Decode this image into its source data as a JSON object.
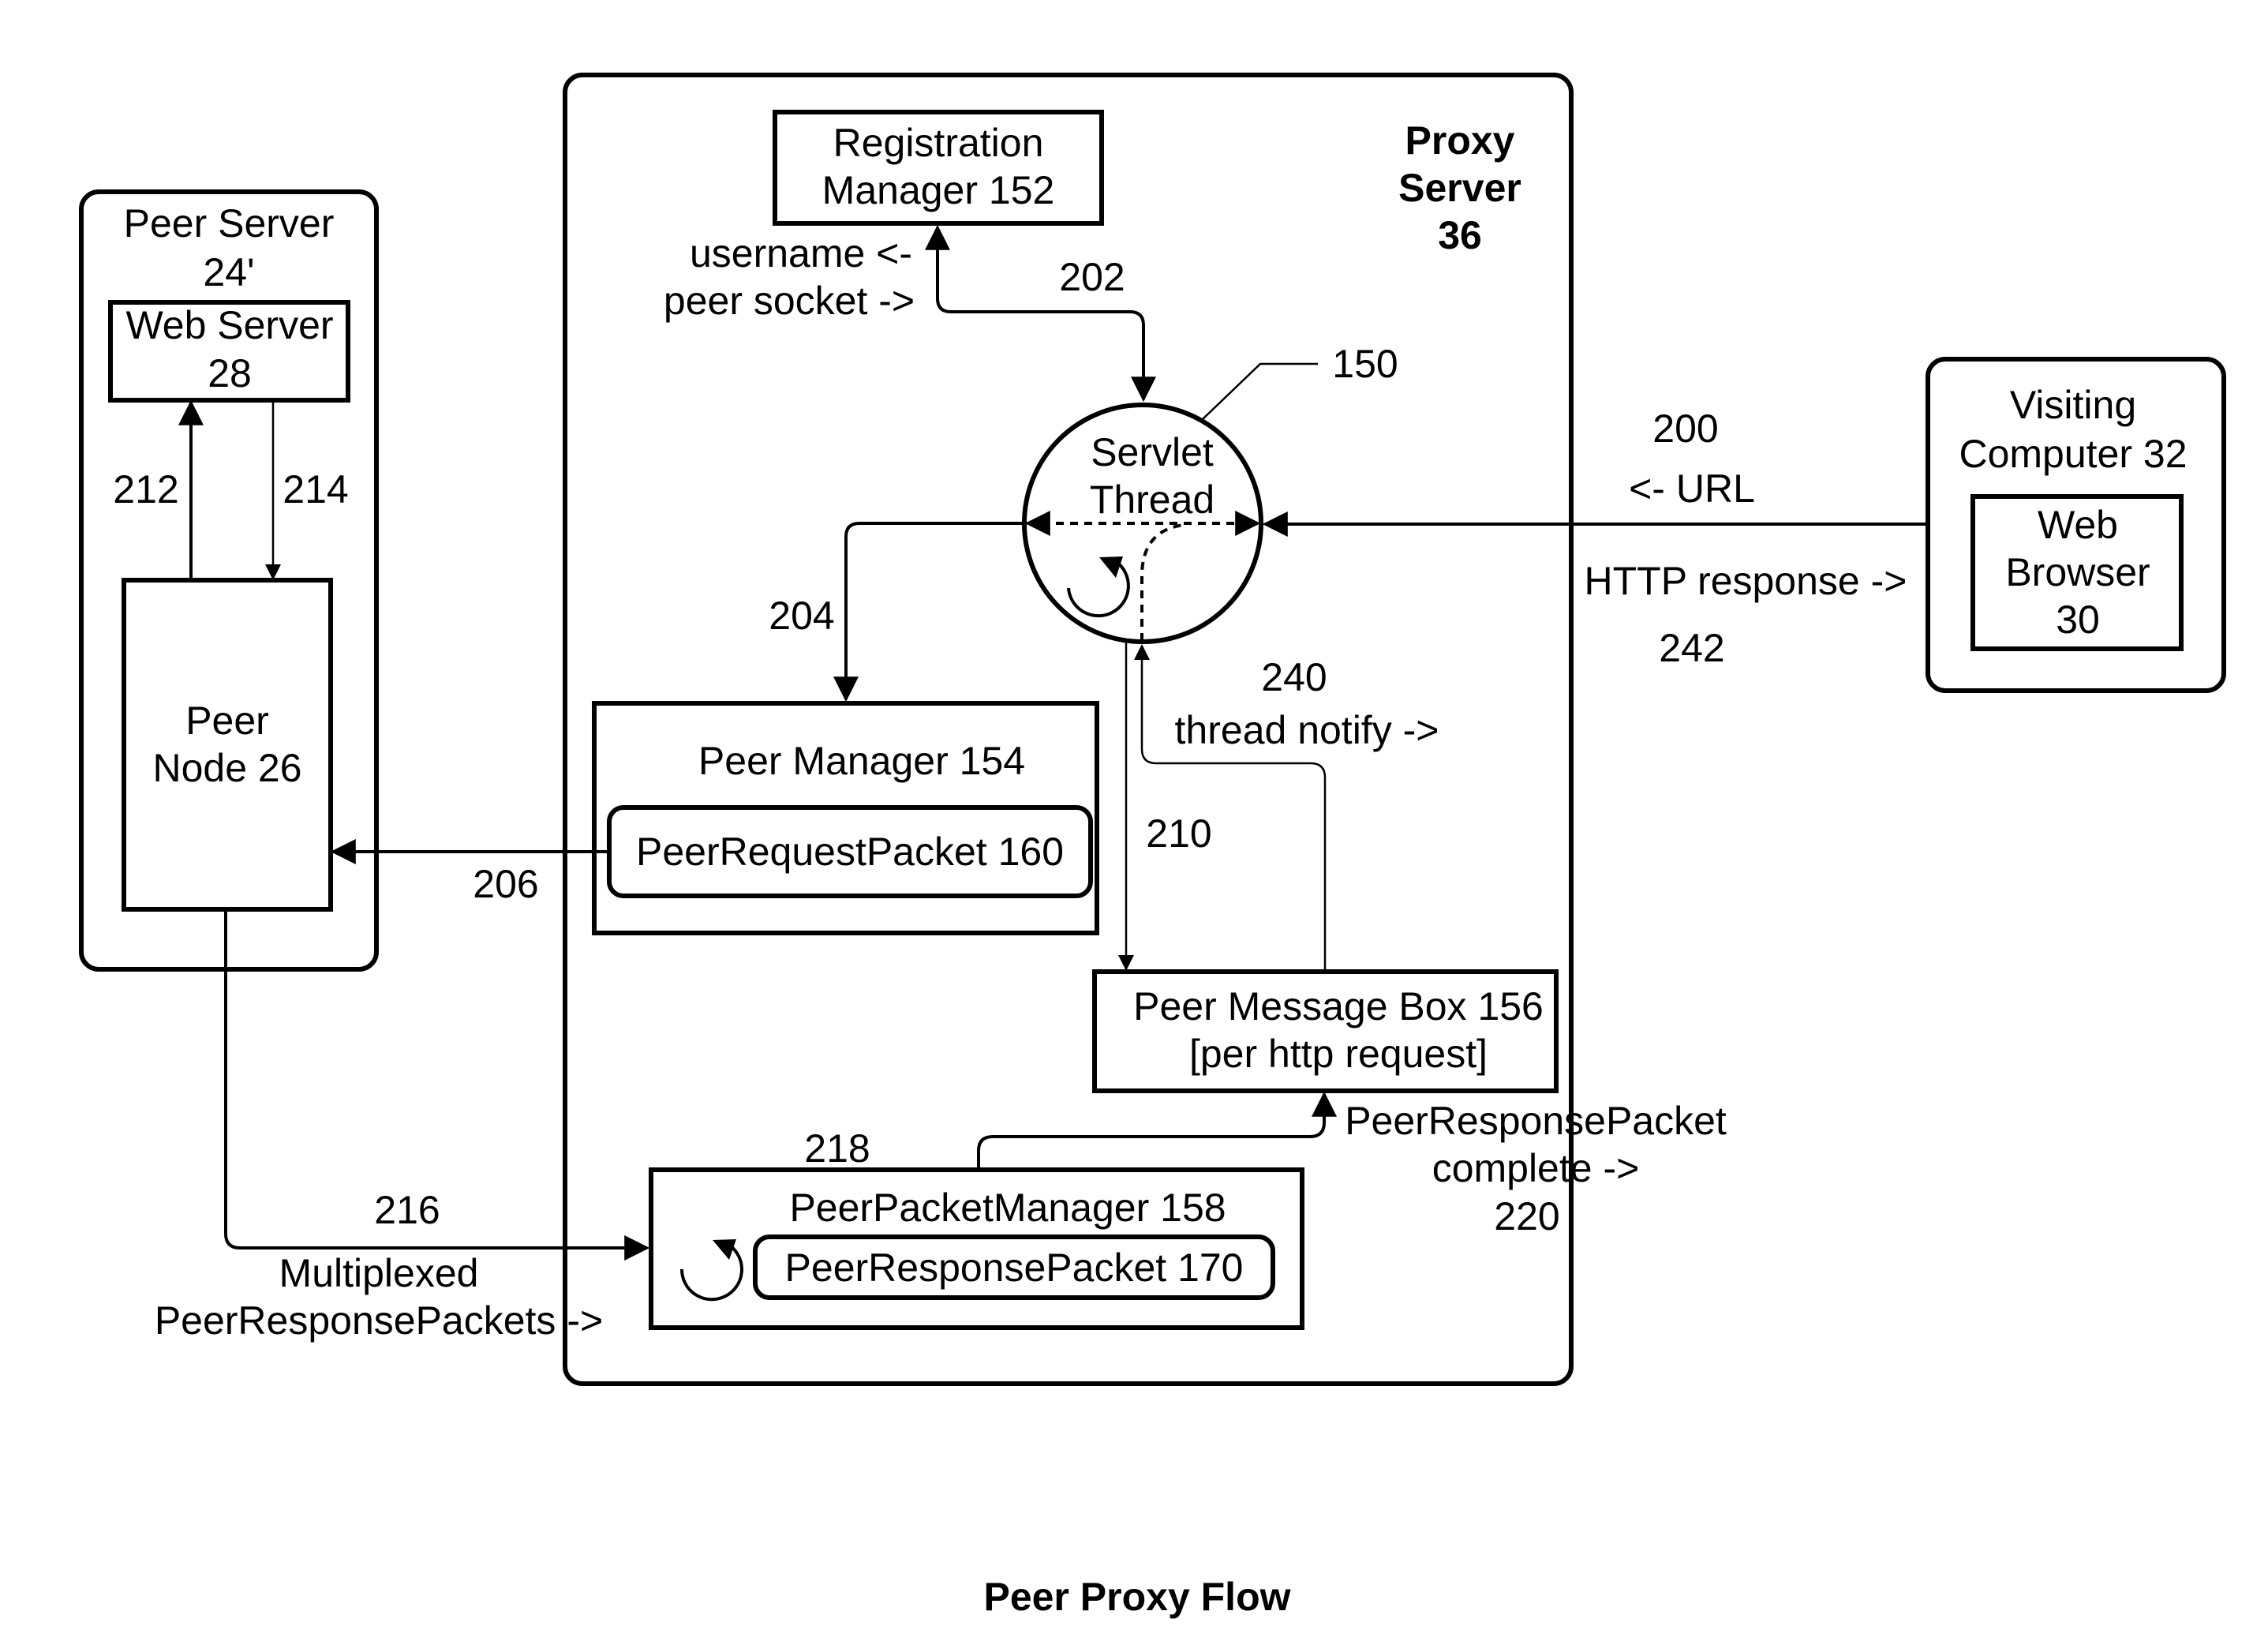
{
  "title": "Peer Proxy Flow",
  "nodes": {
    "peer_server": {
      "line1": "Peer Server",
      "line2": "24'"
    },
    "web_server": {
      "line1": "Web Server",
      "line2": "28"
    },
    "peer_node": {
      "line1": "Peer",
      "line2": "Node 26"
    },
    "proxy_server": {
      "line1": "Proxy",
      "line2": "Server",
      "line3": "36"
    },
    "registration_manager": {
      "line1": "Registration",
      "line2": "Manager 152"
    },
    "servlet_thread": {
      "line1": "Servlet",
      "line2": "Thread",
      "ref": "150"
    },
    "peer_manager": {
      "label": "Peer Manager  154"
    },
    "peer_request_packet": {
      "label": "PeerRequestPacket 160"
    },
    "peer_message_box": {
      "line1": "Peer Message Box 156",
      "line2": "[per http request]"
    },
    "peer_packet_manager": {
      "label": "PeerPacketManager 158"
    },
    "peer_response_packet": {
      "label": "PeerResponsePacket 170"
    },
    "visiting_computer": {
      "line1": "Visiting",
      "line2": "Computer 32"
    },
    "web_browser": {
      "line1": "Web",
      "line2": "Browser",
      "line3": "30"
    }
  },
  "flows": {
    "f200": {
      "num": "200",
      "text": "<- URL"
    },
    "f242": {
      "num": "242",
      "text": "HTTP response ->"
    },
    "f202": {
      "num": "202",
      "text1": "username <-",
      "text2": "peer socket ->"
    },
    "f204": {
      "num": "204"
    },
    "f206": {
      "num": "206"
    },
    "f210": {
      "num": "210"
    },
    "f212": {
      "num": "212"
    },
    "f214": {
      "num": "214"
    },
    "f216": {
      "num": "216",
      "text1": "Multiplexed",
      "text2": "PeerResponsePackets ->"
    },
    "f218": {
      "num": "218"
    },
    "f220": {
      "num": "220",
      "text1": "PeerResponsePacket",
      "text2": "complete ->"
    },
    "f240": {
      "num": "240",
      "text": "thread notify ->"
    }
  }
}
